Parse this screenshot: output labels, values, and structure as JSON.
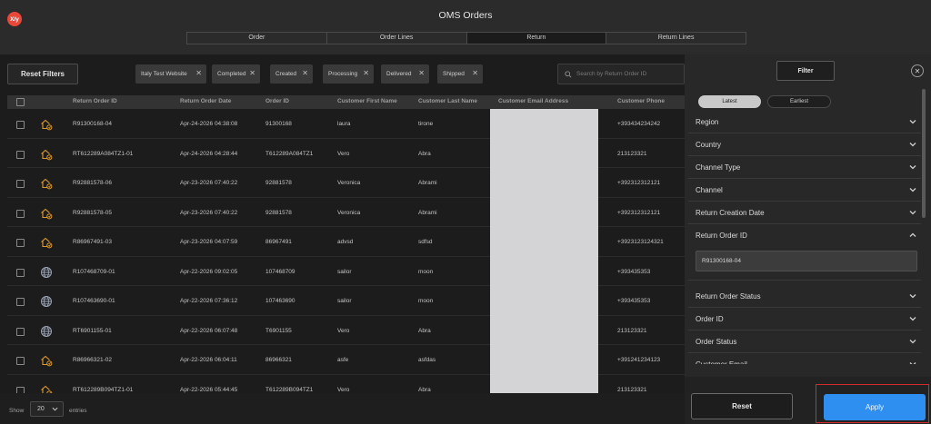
{
  "app": {
    "logo_text": "X/y",
    "title": "OMS Orders"
  },
  "tabs": [
    {
      "label": "Order",
      "active": false
    },
    {
      "label": "Order Lines",
      "active": false
    },
    {
      "label": "Return",
      "active": true
    },
    {
      "label": "Return Lines",
      "active": false
    }
  ],
  "toolbar": {
    "reset_filters_label": "Reset Filters",
    "chips": [
      "Italy Test Website",
      "Completed",
      "Created",
      "Processing",
      "Delivered",
      "Shipped"
    ],
    "chip_remove": "✕",
    "search_placeholder": "Search by Return Order ID"
  },
  "table": {
    "columns": [
      "Return Order ID",
      "Return Order Date",
      "Order ID",
      "Customer First Name",
      "Customer Last Name",
      "Customer Email Address",
      "Customer Phone"
    ],
    "rows": [
      {
        "icon": "house-return-icon",
        "return_order_id": "R91300168-04",
        "return_order_date": "Apr-24-2026 04:38:08",
        "order_id": "91300168",
        "first_name": "laura",
        "last_name": "tirone",
        "phone": "+393434234242"
      },
      {
        "icon": "house-return-icon",
        "return_order_id": "RT612289A084TZ1-01",
        "return_order_date": "Apr-24-2026 04:28:44",
        "order_id": "T612289A084TZ1",
        "first_name": "Vero",
        "last_name": "Abra",
        "phone": "213123321"
      },
      {
        "icon": "house-return-icon",
        "return_order_id": "R92881578-06",
        "return_order_date": "Apr-23-2026 07:40:22",
        "order_id": "92881578",
        "first_name": "Veronica",
        "last_name": "Abrami",
        "phone": "+392312312121"
      },
      {
        "icon": "house-return-icon",
        "return_order_id": "R92881578-05",
        "return_order_date": "Apr-23-2026 07:40:22",
        "order_id": "92881578",
        "first_name": "Veronica",
        "last_name": "Abrami",
        "phone": "+392312312121"
      },
      {
        "icon": "house-return-icon",
        "return_order_id": "R86967491-03",
        "return_order_date": "Apr-23-2026 04:07:59",
        "order_id": "86967491",
        "first_name": "advsd",
        "last_name": "sdfsd",
        "phone": "+3923123124321"
      },
      {
        "icon": "globe-icon",
        "return_order_id": "R107468709-01",
        "return_order_date": "Apr-22-2026 09:02:05",
        "order_id": "107468709",
        "first_name": "sailor",
        "last_name": "moon",
        "phone": "+393435353"
      },
      {
        "icon": "globe-icon",
        "return_order_id": "R107463690-01",
        "return_order_date": "Apr-22-2026 07:36:12",
        "order_id": "107463690",
        "first_name": "sailor",
        "last_name": "moon",
        "phone": "+393435353"
      },
      {
        "icon": "globe-icon",
        "return_order_id": "RT6901155-01",
        "return_order_date": "Apr-22-2026 06:07:48",
        "order_id": "T6901155",
        "first_name": "Vero",
        "last_name": "Abra",
        "phone": "213123321"
      },
      {
        "icon": "house-return-icon",
        "return_order_id": "R86966321-02",
        "return_order_date": "Apr-22-2026 06:04:11",
        "order_id": "86966321",
        "first_name": "asfe",
        "last_name": "asfdas",
        "phone": "+391241234123"
      },
      {
        "icon": "house-return-icon",
        "return_order_id": "RT612289B094TZ1-01",
        "return_order_date": "Apr-22-2026 05:44:45",
        "order_id": "T612289B094TZ1",
        "first_name": "Vero",
        "last_name": "Abra",
        "phone": "213123321"
      }
    ]
  },
  "footer": {
    "show_label": "Show",
    "page_size": "20",
    "entries_label": "entries"
  },
  "panel": {
    "title": "Filter",
    "close_glyph": "✕",
    "sort": {
      "latest": "Latest",
      "earliest": "Earliest",
      "selected": "Latest"
    },
    "facets": [
      {
        "label": "Region",
        "expanded": false
      },
      {
        "label": "Country",
        "expanded": false
      },
      {
        "label": "Channel Type",
        "expanded": false
      },
      {
        "label": "Channel",
        "expanded": false
      },
      {
        "label": "Return Creation Date",
        "expanded": false
      },
      {
        "label": "Return Order ID",
        "expanded": true,
        "value": "R91300168-04"
      },
      {
        "label": "Return Order Status",
        "expanded": false
      },
      {
        "label": "Order ID",
        "expanded": false
      },
      {
        "label": "Order Status",
        "expanded": false
      },
      {
        "label": "Customer Email",
        "expanded": false
      }
    ],
    "reset_label": "Reset",
    "apply_label": "Apply"
  },
  "colors": {
    "accent": "#2f8ff0",
    "highlight_outline": "#d22b2b",
    "logo": "#e8473a",
    "icon_orange": "#e09a2c"
  }
}
